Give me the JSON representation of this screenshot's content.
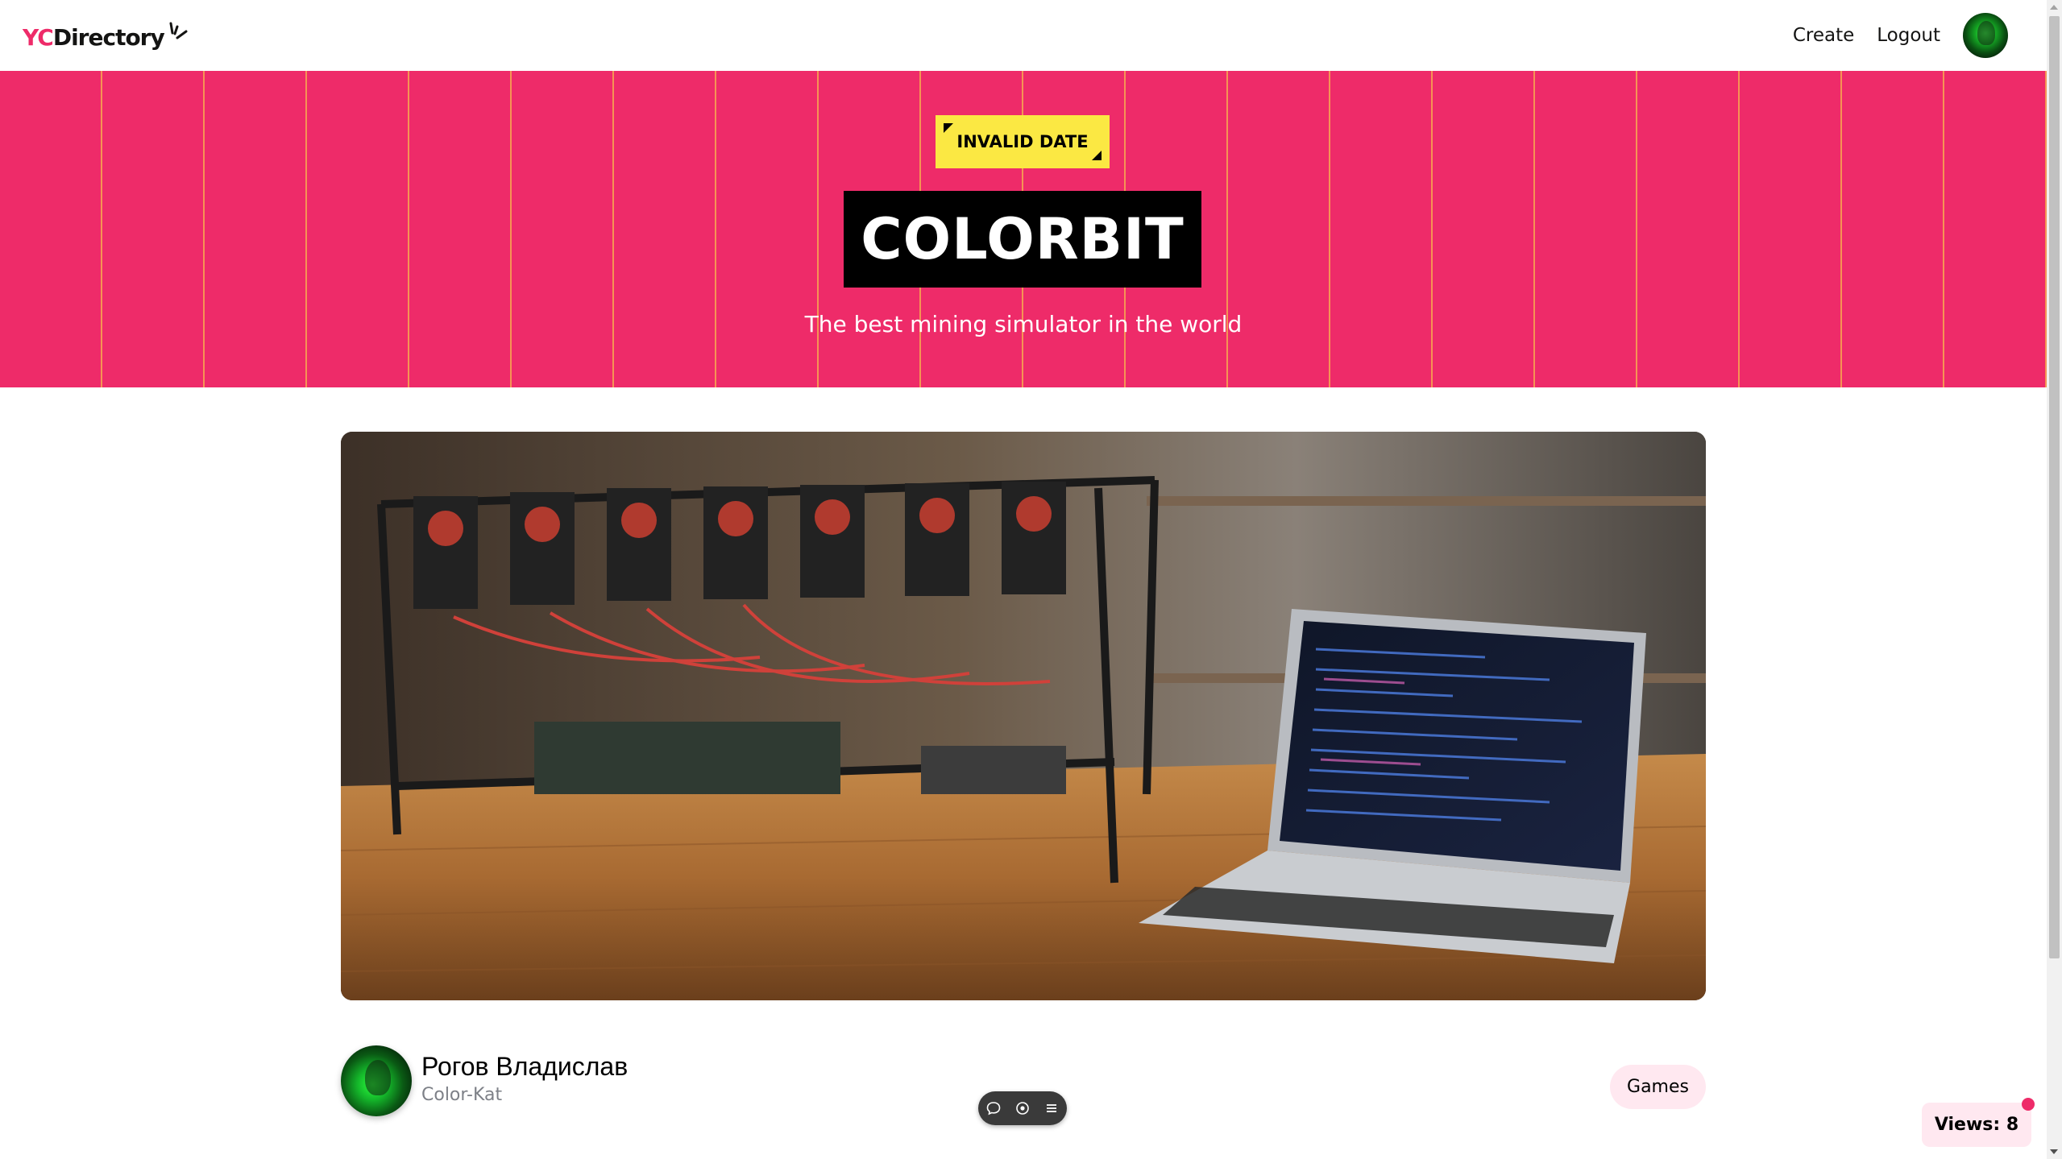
{
  "navbar": {
    "logo_yc": "YC",
    "logo_rest": "Directory",
    "links": {
      "create": "Create",
      "logout": "Logout"
    }
  },
  "hero": {
    "date_tag": "INVALID DATE",
    "title": "COLORBIT",
    "subtitle": "The best mining simulator in the world"
  },
  "startup": {
    "author_name": "Рогов Владислав",
    "author_handle": "Color-Kat",
    "category": "Games",
    "views_label": "Views: 8"
  },
  "colors": {
    "primary": "#EE2B69",
    "secondary": "#FBE843",
    "pill_bg": "#FFE8F0",
    "black": "#000000",
    "handle_gray": "#7D8087"
  },
  "icons": {
    "logo_mark": "spark-icon",
    "toolbar": [
      "comment-icon",
      "eye-icon",
      "menu-icon"
    ]
  }
}
